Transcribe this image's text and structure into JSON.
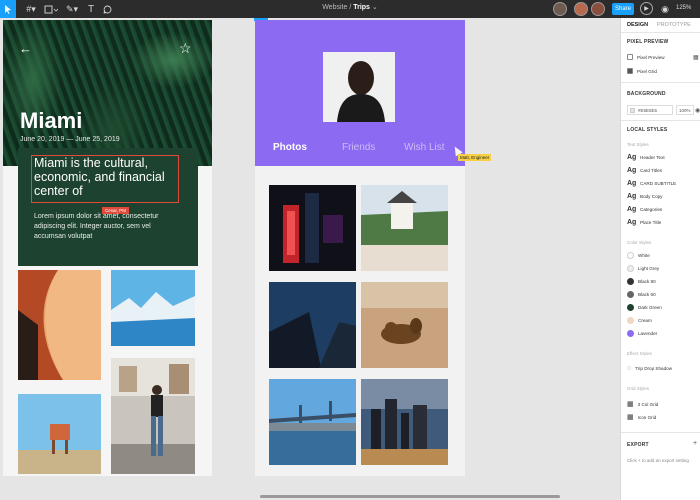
{
  "toolbar": {
    "doc_project": "Website",
    "doc_separator": " / ",
    "doc_name": "Trips",
    "doc_caret": "⌄",
    "share_label": "Share",
    "zoom": "125%"
  },
  "left_frame": {
    "city": "Miami",
    "dates": "June 20, 2019 — June 25, 2019",
    "card_title": "Miami is the cultural, economic, and financial center of",
    "cursor_label": "Cesar, PM",
    "card_body": "Lorem ipsum dolor sit amet, consectetur adipiscing elit. Integer auctor, sem vel accumsan volutpat"
  },
  "right_frame": {
    "tabs": [
      "Photos",
      "Friends",
      "Wish List"
    ],
    "cursor_tag": "Matt, Engineer"
  },
  "panel": {
    "tabs": [
      "DESIGN",
      "PROTOTYPE"
    ],
    "pixel_preview_title": "PIXEL PREVIEW",
    "pixel_preview": "Pixel Preview",
    "pixel_grid": "Pixel Grid",
    "background_title": "BACKGROUND",
    "bg_hex": "#E5E5E5",
    "bg_opacity": "100%",
    "local_styles_title": "LOCAL STYLES",
    "text_styles_title": "Text Styles",
    "text_styles": [
      "Header Text",
      "Card Titles",
      "CARD SUBTITLE",
      "Body Copy",
      "Categories",
      "Place Title"
    ],
    "color_styles_title": "Color Styles",
    "color_styles": [
      {
        "name": "White",
        "color": "#ffffff"
      },
      {
        "name": "Light Grey",
        "color": "#eeeeee"
      },
      {
        "name": "Black 80",
        "color": "#333333"
      },
      {
        "name": "Black 60",
        "color": "#666666"
      },
      {
        "name": "Dark Green",
        "color": "#1e4230"
      },
      {
        "name": "Cream",
        "color": "#f1d7c0"
      },
      {
        "name": "Lavender",
        "color": "#8c6bf2"
      }
    ],
    "effect_styles_title": "Effect Styles",
    "effect_styles": [
      "Trip Drop Shadow"
    ],
    "grid_styles_title": "Grid Styles",
    "grid_styles": [
      "3 Col Grid",
      "Icon Grid"
    ],
    "export_title": "EXPORT",
    "export_hint": "Click + to add an export setting"
  }
}
